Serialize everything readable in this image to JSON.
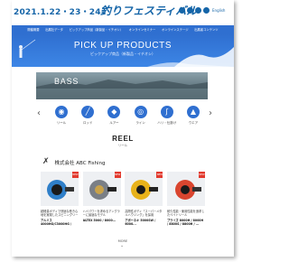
{
  "header": {
    "dates": "2021.1.22・23・24",
    "logo": "釣りフェスティバル",
    "socials": [
      "twitter-icon",
      "facebook-icon",
      "instagram-icon",
      "youtube-icon"
    ],
    "language": "English"
  },
  "nav": {
    "items": [
      "開催概要",
      "出展社データ",
      "ピックアップ商品（新製品・イチオシ）",
      "オンラインセミナー",
      "オンラインステージ",
      "出展者コンテンツ"
    ]
  },
  "hero": {
    "title": "PICK UP PRODUCTS",
    "subtitle": "ピックアップ商品（新製品・イチオシ）"
  },
  "banner": {
    "label": "BASS"
  },
  "carousel": {
    "prev": "‹",
    "next": "›",
    "categories": [
      {
        "label": "リール",
        "icon": "reel-icon"
      },
      {
        "label": "ロッド",
        "icon": "rod-icon"
      },
      {
        "label": "ルアー",
        "icon": "lure-icon"
      },
      {
        "label": "ライン",
        "icon": "line-icon"
      },
      {
        "label": "ハリ・仕掛け",
        "icon": "hook-icon"
      },
      {
        "label": "ウエア",
        "icon": "wear-icon"
      }
    ]
  },
  "section": {
    "title": "REEL",
    "subtitle": "リール"
  },
  "company": {
    "name": "株式会社 ABC Fishing"
  },
  "products": [
    {
      "desc": "超軽量ボディで快適な巻き心地を実現したスピニングリール",
      "name": "アルミス 4000HG/C3000HG / C2000S / S...",
      "badge": "NEW",
      "color": "#2f7fc9"
    },
    {
      "desc": "ハイパワーを求めるアングラーに最適なモデル",
      "name": "ALTEX 5000 / 8000...",
      "badge": "NEW",
      "color": "#7a7f86"
    },
    {
      "desc": "高剛性ボディ「スーパーメタルハウジング」を採用",
      "name": "アポーネキ 5000SW / 6000...",
      "badge": "NEW",
      "color": "#e8b21a"
    },
    {
      "desc": "耐久性能・使用性能を追求したベイトリール",
      "name": "プライズ 8000H / 8000H / 8800S / 8800H / ...",
      "badge": "NEW",
      "color": "#d9452f"
    }
  ],
  "more": {
    "label": "MORE",
    "chevron": "⌄"
  },
  "colors": {
    "accent": "#2f6fd0",
    "brand": "#1565a8",
    "badge": "#e23a2e"
  }
}
